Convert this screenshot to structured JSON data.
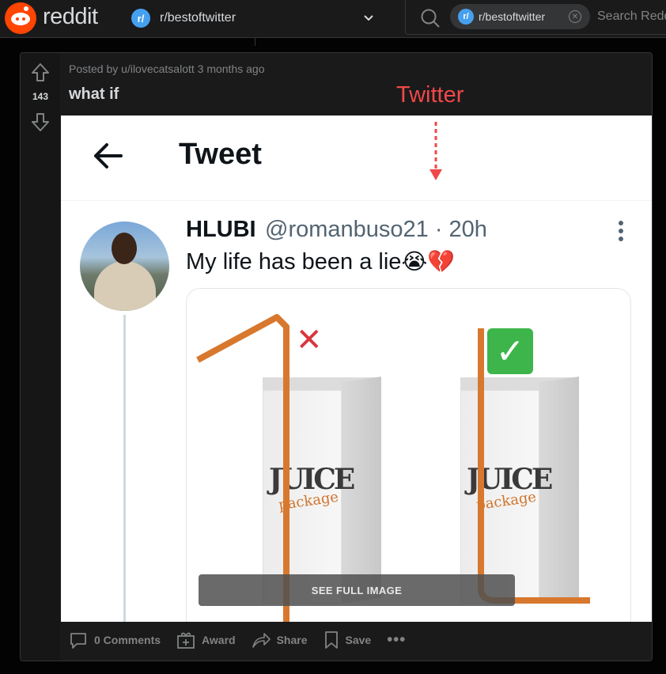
{
  "header": {
    "brand": "reddit",
    "subreddit": "r/bestoftwitter",
    "subreddit_icon": "r/",
    "search_chip": "r/bestoftwitter",
    "search_placeholder": "Search Reddit"
  },
  "post": {
    "score": "143",
    "meta": "Posted by u/ilovecatsalott 3 months ago",
    "title": "what if",
    "annotation": "Twitter",
    "tweet": {
      "header_title": "Tweet",
      "name": "HLUBI",
      "handle": "@romanbuso21 · 20h",
      "text": "My life has been a lie",
      "emoji": "😭💔",
      "juice_label": "JUICE",
      "package_label": "package",
      "wrong_mark": "✕",
      "right_mark": "✓"
    },
    "see_full_image": "SEE FULL IMAGE",
    "actions": {
      "comments": "0 Comments",
      "award": "Award",
      "share": "Share",
      "save": "Save",
      "more": "•••"
    }
  },
  "colors": {
    "accent": "#ff4500",
    "subreddit_icon": "#46a0f0",
    "annotation": "#f04848",
    "straw": "#d8782e"
  }
}
